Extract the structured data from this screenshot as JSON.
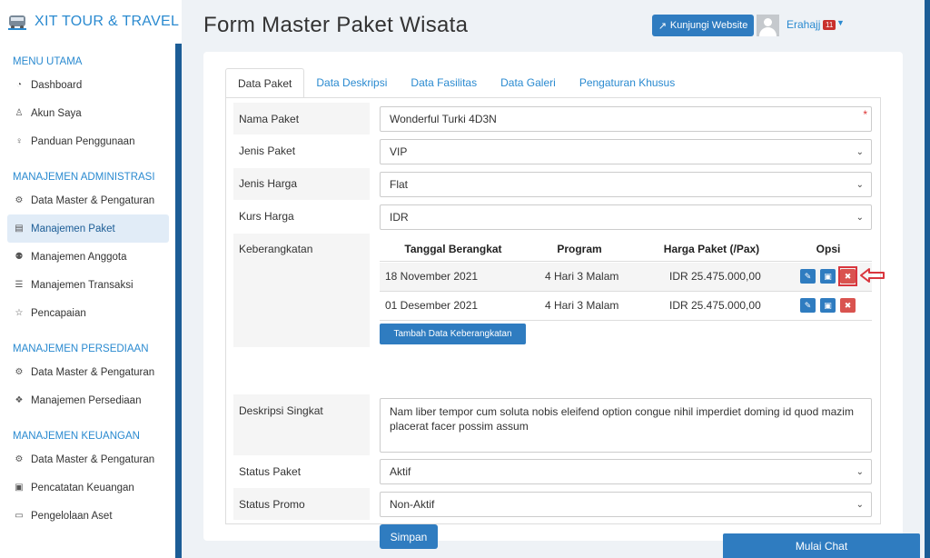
{
  "brand": {
    "name": "XIT TOUR & TRAVEL",
    "logo_icon": "bus-logo-icon"
  },
  "sidebar": {
    "sections": [
      {
        "title": "MENU UTAMA",
        "items": [
          {
            "label": "Dashboard",
            "icon": "dashboard-icon"
          },
          {
            "label": "Akun Saya",
            "icon": "user-icon"
          },
          {
            "label": "Panduan Penggunaan",
            "icon": "lightbulb-icon"
          }
        ]
      },
      {
        "title": "MANAJEMEN ADMINISTRASI",
        "items": [
          {
            "label": "Data Master & Pengaturan",
            "icon": "gears-icon"
          },
          {
            "label": "Manajemen Paket",
            "icon": "book-icon",
            "active": true
          },
          {
            "label": "Manajemen Anggota",
            "icon": "users-icon"
          },
          {
            "label": "Manajemen Transaksi",
            "icon": "cart-icon"
          },
          {
            "label": "Pencapaian",
            "icon": "star-icon"
          }
        ]
      },
      {
        "title": "MANAJEMEN PERSEDIAAN",
        "items": [
          {
            "label": "Data Master & Pengaturan",
            "icon": "gears-icon"
          },
          {
            "label": "Manajemen Persediaan",
            "icon": "cubes-icon"
          }
        ]
      },
      {
        "title": "MANAJEMEN KEUANGAN",
        "items": [
          {
            "label": "Data Master & Pengaturan",
            "icon": "gears-icon"
          },
          {
            "label": "Pencatatan Keuangan",
            "icon": "money-icon"
          },
          {
            "label": "Pengelolaan Aset",
            "icon": "hdd-icon"
          }
        ]
      }
    ]
  },
  "header": {
    "title": "Form Master Paket Wisata",
    "visit_label": "Kunjungi Website",
    "user_name": "Erahajj",
    "notif_count": "11"
  },
  "tabs": [
    "Data Paket",
    "Data Deskripsi",
    "Data Fasilitas",
    "Data Galeri",
    "Pengaturan Khusus"
  ],
  "form": {
    "nama_paket": {
      "label": "Nama Paket",
      "value": "Wonderful Turki 4D3N",
      "required_mark": "*"
    },
    "jenis_paket": {
      "label": "Jenis Paket",
      "value": "VIP"
    },
    "jenis_harga": {
      "label": "Jenis Harga",
      "value": "Flat"
    },
    "kurs_harga": {
      "label": "Kurs Harga",
      "value": "IDR"
    },
    "keberangkatan": {
      "label": "Keberangkatan",
      "columns": [
        "Tanggal Berangkat",
        "Program",
        "Harga Paket (/Pax)",
        "Opsi"
      ],
      "rows": [
        {
          "tanggal": "18 November 2021",
          "program": "4 Hari 3 Malam",
          "harga": "IDR 25.475.000,00"
        },
        {
          "tanggal": "01 Desember 2021",
          "program": "4 Hari 3 Malam",
          "harga": "IDR 25.475.000,00"
        }
      ],
      "add_label": "Tambah Data Keberangkatan"
    },
    "deskripsi": {
      "label": "Deskripsi Singkat",
      "value": "Nam liber tempor cum soluta nobis eleifend option congue nihil imperdiet doming id quod mazim placerat facer possim assum"
    },
    "status_paket": {
      "label": "Status Paket",
      "value": "Aktif"
    },
    "status_promo": {
      "label": "Status Promo",
      "value": "Non-Aktif"
    },
    "save_label": "Simpan"
  },
  "chat_label": "Mulai Chat",
  "colors": {
    "primary": "#2f7cc0",
    "danger": "#d9534f",
    "sidebar_rail": "#1c5d96",
    "accent_text": "#2a8ad0"
  }
}
